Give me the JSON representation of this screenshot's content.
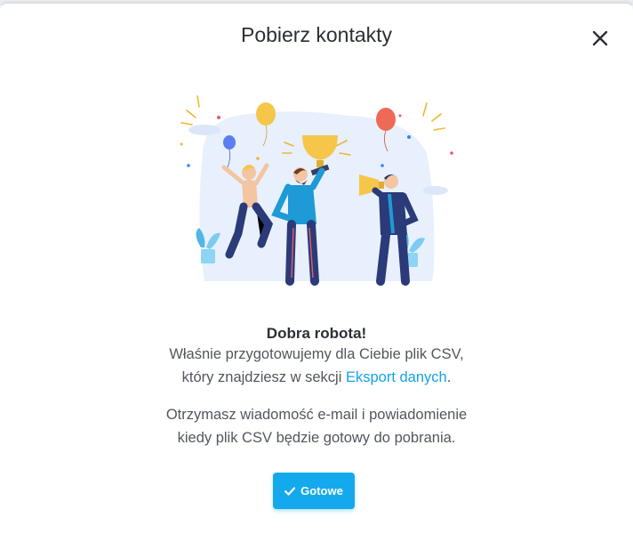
{
  "modal": {
    "title": "Pobierz kontakty",
    "close_icon": "close-icon"
  },
  "content": {
    "heading": "Dobra robota!",
    "line1": "Właśnie przygotowujemy dla Ciebie plik CSV,",
    "line2_prefix": "który znajdziesz w sekcji ",
    "line2_link": "Eksport danych",
    "line2_suffix": ".",
    "line3": "Otrzymasz wiadomość e-mail i powiadomienie",
    "line4": "kiedy plik CSV będzie gotowy do pobrania."
  },
  "done_button": {
    "label": "Gotowe",
    "icon": "check-icon"
  },
  "colors": {
    "accent": "#14a9ec",
    "link": "#13a3e8",
    "text": "#2c2f36",
    "muted_text": "#52565e"
  }
}
